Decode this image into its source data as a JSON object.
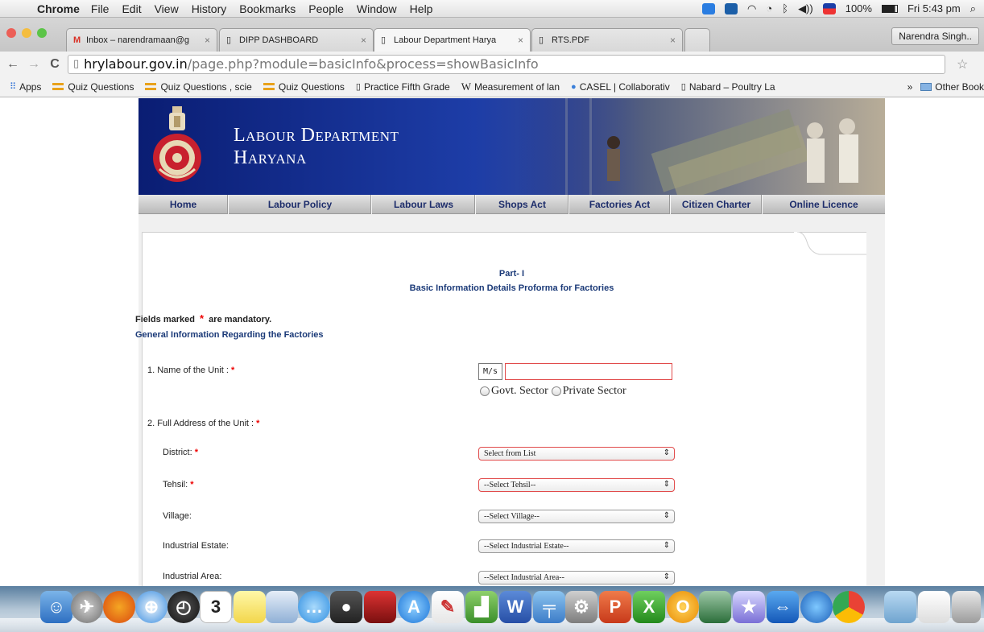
{
  "menubar": {
    "app_name": "Chrome",
    "items": [
      "File",
      "Edit",
      "View",
      "History",
      "Bookmarks",
      "People",
      "Window",
      "Help"
    ],
    "battery": "100%",
    "clock": "Fri 5:43 pm"
  },
  "tabs": [
    {
      "label": "Inbox – narendramaan@g",
      "icon": "gmail-icon",
      "active": false
    },
    {
      "label": "DIPP DASHBOARD",
      "icon": "page-icon",
      "active": false
    },
    {
      "label": "Labour Department Harya",
      "icon": "page-icon",
      "active": true
    },
    {
      "label": "RTS.PDF",
      "icon": "page-icon",
      "active": false
    }
  ],
  "profile_name": "Narendra Singh..",
  "address": {
    "host": "hrylabour.gov.in",
    "path": "/page.php?module=basicInfo&process=showBasicInfo"
  },
  "bookmarks": {
    "items": [
      {
        "label": "Apps",
        "icon": "apps-grid-icon"
      },
      {
        "label": "Quiz Questions",
        "icon": "folder-bar-icon"
      },
      {
        "label": "Quiz Questions , scie",
        "icon": "folder-bar-icon"
      },
      {
        "label": "Quiz Questions",
        "icon": "folder-bar-icon"
      },
      {
        "label": "Practice Fifth Grade",
        "icon": "page-icon"
      },
      {
        "label": "Measurement of lan",
        "icon": "wikipedia-icon"
      },
      {
        "label": "CASEL | Collaborativ",
        "icon": "globe-icon"
      },
      {
        "label": "Nabard – Poultry La",
        "icon": "page-icon"
      }
    ],
    "other": "Other Book"
  },
  "site": {
    "title_line1": "Labour Department",
    "title_line2": "Haryana",
    "nav": [
      "Home",
      "Labour Policy",
      "Labour Laws",
      "Shops Act",
      "Factories Act",
      "Citizen Charter",
      "Online Licence"
    ]
  },
  "form": {
    "part": "Part- I",
    "heading": "Basic Information Details Proforma for Factories",
    "mandatory_note_pre": "Fields marked",
    "mandatory_note_post": "are mandatory.",
    "asterisk": "*",
    "section_title": "General Information Regarding the Factories",
    "q1_label": "1.  Name of the Unit :",
    "ms_prefix": "M/s",
    "unit_name_value": "",
    "sector_govt": "Govt. Sector",
    "sector_private": "Private Sector",
    "q2_label": "2.  Full Address of the Unit :",
    "district_label": "District:",
    "district_value": "Select from List",
    "tehsil_label": "Tehsil:",
    "tehsil_value": "--Select Tehsil--",
    "village_label": "Village:",
    "village_value": "--Select Village--",
    "estate_label": "Industrial Estate:",
    "estate_value": "--Select Industrial Estate--",
    "area_label": "Industrial Area:",
    "area_value": "--Select Industrial Area--"
  },
  "colors": {
    "nav_text": "#1d2d6b",
    "heading_blue": "#1b3a78",
    "required_red": "#e00000",
    "banner_blue": "#0a1d73"
  },
  "dock": {
    "calendar_day": "3",
    "apps": [
      "finder-icon",
      "launchpad-icon",
      "firefox-icon",
      "safari-icon",
      "dashboard-icon",
      "calendar-icon",
      "stickies-icon",
      "preview-icon",
      "messages-icon",
      "facetime-icon",
      "photo-booth-icon",
      "app-store-icon",
      "textedit-icon",
      "numbers-icon",
      "word-icon",
      "keynote-icon",
      "system-preferences-icon",
      "powerpoint-icon",
      "excel-icon",
      "opera-icon",
      "image-capture-icon",
      "imovie-star-icon",
      "teamviewer-icon",
      "google-earth-icon",
      "chrome-icon",
      "downloads-folder-icon",
      "documents-icon",
      "trash-icon"
    ]
  }
}
